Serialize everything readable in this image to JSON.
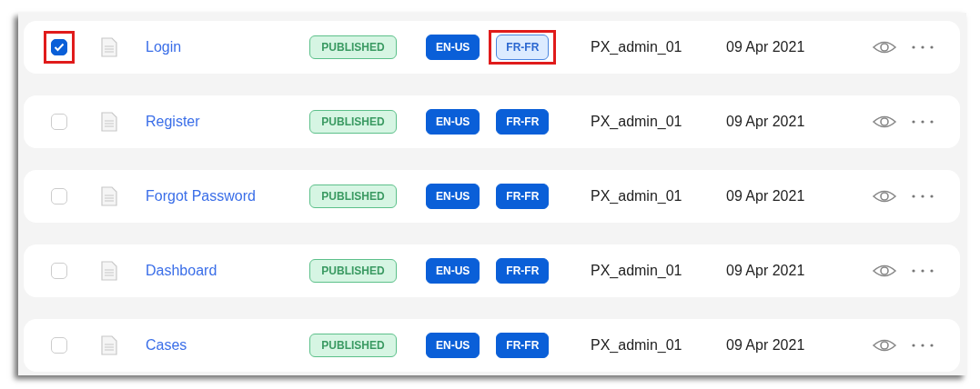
{
  "rows": [
    {
      "checked": true,
      "highlighted": true,
      "name": "Login",
      "status": "PUBLISHED",
      "locales": [
        {
          "label": "EN-US",
          "selected": false,
          "highlighted": false
        },
        {
          "label": "FR-FR",
          "selected": true,
          "highlighted": true
        }
      ],
      "author": "PX_admin_01",
      "date": "09 Apr 2021"
    },
    {
      "checked": false,
      "highlighted": false,
      "name": "Register",
      "status": "PUBLISHED",
      "locales": [
        {
          "label": "EN-US",
          "selected": false,
          "highlighted": false
        },
        {
          "label": "FR-FR",
          "selected": false,
          "highlighted": false
        }
      ],
      "author": "PX_admin_01",
      "date": "09 Apr 2021"
    },
    {
      "checked": false,
      "highlighted": false,
      "name": "Forgot Password",
      "status": "PUBLISHED",
      "locales": [
        {
          "label": "EN-US",
          "selected": false,
          "highlighted": false
        },
        {
          "label": "FR-FR",
          "selected": false,
          "highlighted": false
        }
      ],
      "author": "PX_admin_01",
      "date": "09 Apr 2021"
    },
    {
      "checked": false,
      "highlighted": false,
      "name": "Dashboard",
      "status": "PUBLISHED",
      "locales": [
        {
          "label": "EN-US",
          "selected": false,
          "highlighted": false
        },
        {
          "label": "FR-FR",
          "selected": false,
          "highlighted": false
        }
      ],
      "author": "PX_admin_01",
      "date": "09 Apr 2021"
    },
    {
      "checked": false,
      "highlighted": false,
      "name": "Cases",
      "status": "PUBLISHED",
      "locales": [
        {
          "label": "EN-US",
          "selected": false,
          "highlighted": false
        },
        {
          "label": "FR-FR",
          "selected": false,
          "highlighted": false
        }
      ],
      "author": "PX_admin_01",
      "date": "09 Apr 2021"
    }
  ]
}
